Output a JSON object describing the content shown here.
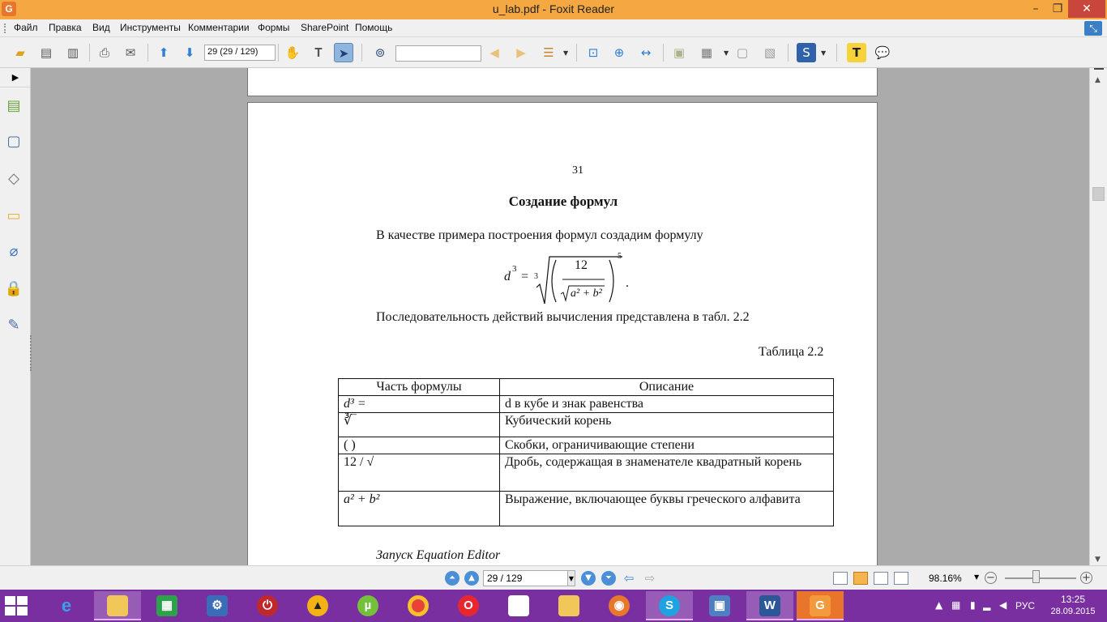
{
  "window": {
    "title": "u_lab.pdf - Foxit Reader",
    "app_logo": "G"
  },
  "menu": [
    "Файл",
    "Правка",
    "Вид",
    "Инструменты",
    "Комментарии",
    "Формы",
    "SharePoint",
    "Помощь"
  ],
  "toolbar": {
    "page_field": "29 (29 / 129)",
    "search_value": ""
  },
  "document": {
    "page_number": "31",
    "heading": "Создание формул",
    "para1": "В качестве примера построения формул создадим формулу",
    "formula": {
      "lhs": "d",
      "lhs_exp": "3",
      "equals": "=",
      "root_index": "3",
      "numerator": "12",
      "radicand": "a² + b²",
      "outer_exp": "5",
      "end": "."
    },
    "para2": "Последовательность действий вычисления представлена в табл. 2.2",
    "table_caption": "Таблица 2.2",
    "table": {
      "headers": [
        "Часть формулы",
        "Описание"
      ],
      "rows": [
        {
          "part": "d³ =",
          "desc": "d в кубе и знак равенства"
        },
        {
          "part": "∛‾",
          "desc": "Кубический корень"
        },
        {
          "part": "( )",
          "desc": "Скобки, ограничивающие степени"
        },
        {
          "part": "12 / √",
          "desc": "Дробь, содержащая в знаменателе квадратный корень"
        },
        {
          "part": "a² + b²",
          "desc": "Выражение, включающее буквы греческого алфавита"
        }
      ]
    },
    "section_title": "Запуск Equation Editor"
  },
  "statusbar": {
    "page": "29 / 129",
    "zoom": "98.16%"
  },
  "taskbar": {
    "language": "РУС",
    "time": "13:25",
    "date": "28.09.2015"
  },
  "colors": {
    "titlebar": "#f5a742",
    "taskbar": "#7a2fa0",
    "accent": "#2d7fd3"
  }
}
